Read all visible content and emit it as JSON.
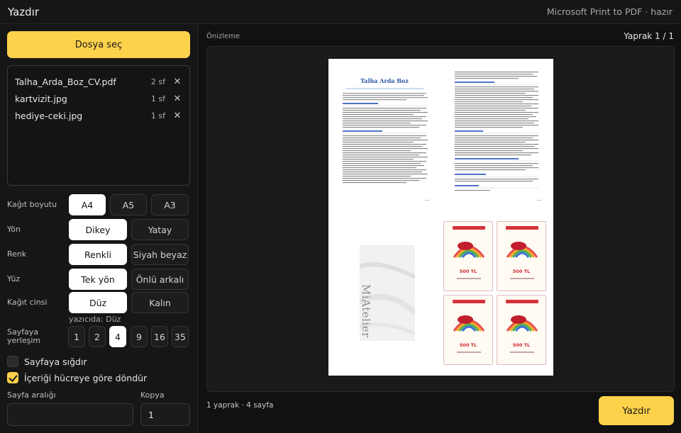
{
  "app": {
    "title": "Yazdır",
    "printer_status": "Microsoft Print to PDF · hazır"
  },
  "sidebar": {
    "choose_file_label": "Dosya seç",
    "files": [
      {
        "name": "Talha_Arda_Boz_CV.pdf",
        "pages": "2 sf",
        "remove_icon": "close-icon"
      },
      {
        "name": "kartvizit.jpg",
        "pages": "1 sf",
        "remove_icon": "close-icon"
      },
      {
        "name": "hediye-ceki.jpg",
        "pages": "1 sf",
        "remove_icon": "close-icon"
      }
    ],
    "paper_size": {
      "label": "Kağıt boyutu",
      "options": [
        "A4",
        "A5",
        "A3"
      ],
      "selected": "A4"
    },
    "orientation": {
      "label": "Yön",
      "options": [
        "Dikey",
        "Yatay"
      ],
      "selected": "Dikey"
    },
    "color": {
      "label": "Renk",
      "options": [
        "Renkli",
        "Siyah beyaz"
      ],
      "selected": "Renkli"
    },
    "sides": {
      "label": "Yüz",
      "options": [
        "Tek yön",
        "Önlü arkalı"
      ],
      "selected": "Tek yön"
    },
    "paper_type": {
      "label": "Kağıt cinsi",
      "options": [
        "Düz",
        "Kalın"
      ],
      "selected": "Düz",
      "hint": "yazıcıda: Düz"
    },
    "per_sheet": {
      "label_line1": "Sayfaya",
      "label_line2": "yerleşim",
      "options": [
        "1",
        "2",
        "4",
        "9",
        "16",
        "35"
      ],
      "selected": "4"
    },
    "fit_to_page": {
      "label": "Sayfaya sığdır",
      "checked": false
    },
    "rotate_to_cell": {
      "label": "İçeriği hücreye göre döndür",
      "checked": true
    },
    "page_range": {
      "label": "Sayfa aralığı",
      "value": ""
    },
    "copies": {
      "label": "Kopya",
      "value": "1"
    }
  },
  "main": {
    "preview_label": "Önizleme",
    "sheet_counter": "Yaprak 1 / 1",
    "summary": "1 yaprak · 4 sayfa",
    "print_label": "Yazdır",
    "preview": {
      "cv_name": "Talha Arda Boz",
      "business_card_text": "MiAtelier",
      "gift_card_amount": "500 TL"
    }
  },
  "colors": {
    "accent": "#fdd24b",
    "background": "#111111",
    "panel": "#161616",
    "selected_option": "#ffffff",
    "cv_heading": "#2e58a8",
    "gift_card_red": "#d02a30"
  }
}
